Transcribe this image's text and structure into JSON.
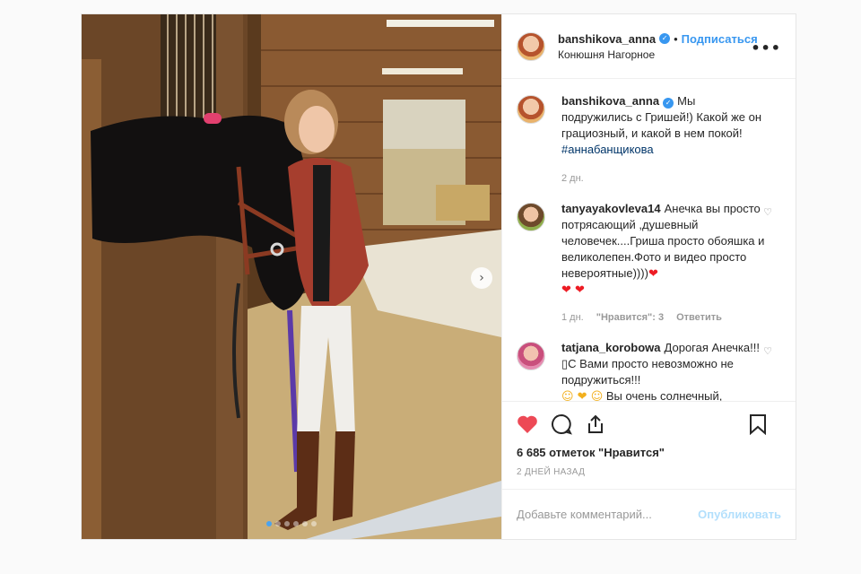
{
  "post": {
    "author": {
      "username": "banshikova_anna",
      "verified": true,
      "follow_label": "Подписаться",
      "location": "Конюшня Нагорное"
    },
    "more_label": "•••",
    "carousel": {
      "total": 6,
      "active": 0,
      "next_icon": "chevron-right-icon"
    },
    "caption": {
      "username": "banshikova_anna",
      "text": "Мы подружились с Гришей!) Какой же он грациозный, и какой в нем покой!",
      "hashtag": "#аннабанщикова",
      "time": "2 дн."
    },
    "comments": [
      {
        "username": "tanyayakovleva14",
        "text": "Анечка вы просто потрясающий ,душевный человечек....Гриша просто обояшка и великолепен.Фото и видео просто невероятные))))",
        "emoji_trail": "❤",
        "emoji_line": "❤ ❤",
        "time": "1 дн.",
        "likes": "\"Нравится\": 3",
        "reply": "Ответить"
      },
      {
        "username": "tatjana_korobowa",
        "text": "Дорогая Анечка!!!▯С Вами просто невозможно не подружиться!!!",
        "emoji_line": "☺ ❤ ☺",
        "tail": "Вы очень солнечный,"
      }
    ],
    "likes_text": "6 685 отметок \"Нравится\"",
    "date_text": "2 ДНЕЙ НАЗАД",
    "comment_input": {
      "placeholder": "Добавьте комментарий...",
      "value": ""
    },
    "publish_label": "Опубликовать",
    "colors": {
      "accent": "#3897f0",
      "like": "#ed4956",
      "publish_disabled": "#b2dffc"
    }
  }
}
